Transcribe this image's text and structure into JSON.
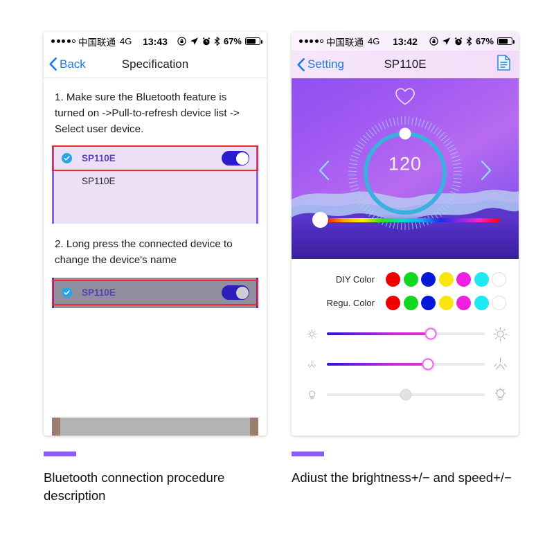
{
  "left_phone": {
    "status_bar": {
      "carrier": "中国联通",
      "network": "4G",
      "time": "13:43",
      "battery_percent": "67%",
      "icons": [
        "signal-dots-icon",
        "rotation-lock-icon",
        "location-arrow-icon",
        "alarm-clock-icon",
        "bluetooth-icon",
        "battery-icon"
      ]
    },
    "nav": {
      "back_label": "Back",
      "title": "Specification"
    },
    "step1_text": "1. Make sure the Bluetooth feature is turned on ->Pull-to-refresh device list -> Select user device.",
    "step2_text": "2. Long press the connected device to change the device's name",
    "device_list_1": [
      {
        "name": "SP110E",
        "checked": true,
        "toggle": "on"
      },
      {
        "name": "SP110E",
        "checked": false,
        "toggle": "none"
      }
    ],
    "device_list_2": [
      {
        "name": "SP110E",
        "checked": true,
        "toggle": "on"
      }
    ]
  },
  "right_phone": {
    "status_bar": {
      "carrier": "中国联通",
      "network": "4G",
      "time": "13:42",
      "battery_percent": "67%"
    },
    "nav": {
      "back_label": "Setting",
      "title": "SP110E",
      "right_icon": "document-icon"
    },
    "dial": {
      "value": "120",
      "favorite_icon": "heart-icon",
      "prev_icon": "chevron-left-icon",
      "next_icon": "chevron-right-icon"
    },
    "hue_slider": {
      "position_percent": 4
    },
    "color_rows": [
      {
        "label": "DIY Color",
        "swatches": [
          "#f00000",
          "#10d820",
          "#0618d8",
          "#f8e512",
          "#ef1fe0",
          "#1fe8f5",
          "empty"
        ]
      },
      {
        "label": "Regu. Color",
        "swatches": [
          "#f00000",
          "#10d820",
          "#0618d8",
          "#f8e512",
          "#ef1fe0",
          "#1fe8f5",
          "empty"
        ]
      }
    ],
    "sliders": [
      {
        "name": "brightness",
        "left_icon": "sun-small-icon",
        "right_icon": "sun-large-icon",
        "value_percent": 66,
        "active": true
      },
      {
        "name": "speed",
        "left_icon": "sparkle-small-icon",
        "right_icon": "sparkle-large-icon",
        "value_percent": 64,
        "active": true
      },
      {
        "name": "bulb",
        "left_icon": "bulb-small-icon",
        "right_icon": "bulb-large-icon",
        "value_percent": 50,
        "active": false
      }
    ]
  },
  "captions": {
    "left": "Bluetooth connection procedure description",
    "right": "Adiust the brightness+/− and speed+/−"
  },
  "colors": {
    "accent_purple": "#8b5cf6",
    "link_blue": "#1a7ced",
    "highlight_red": "#f3262a",
    "toggle_blue": "#2a1ccc"
  }
}
